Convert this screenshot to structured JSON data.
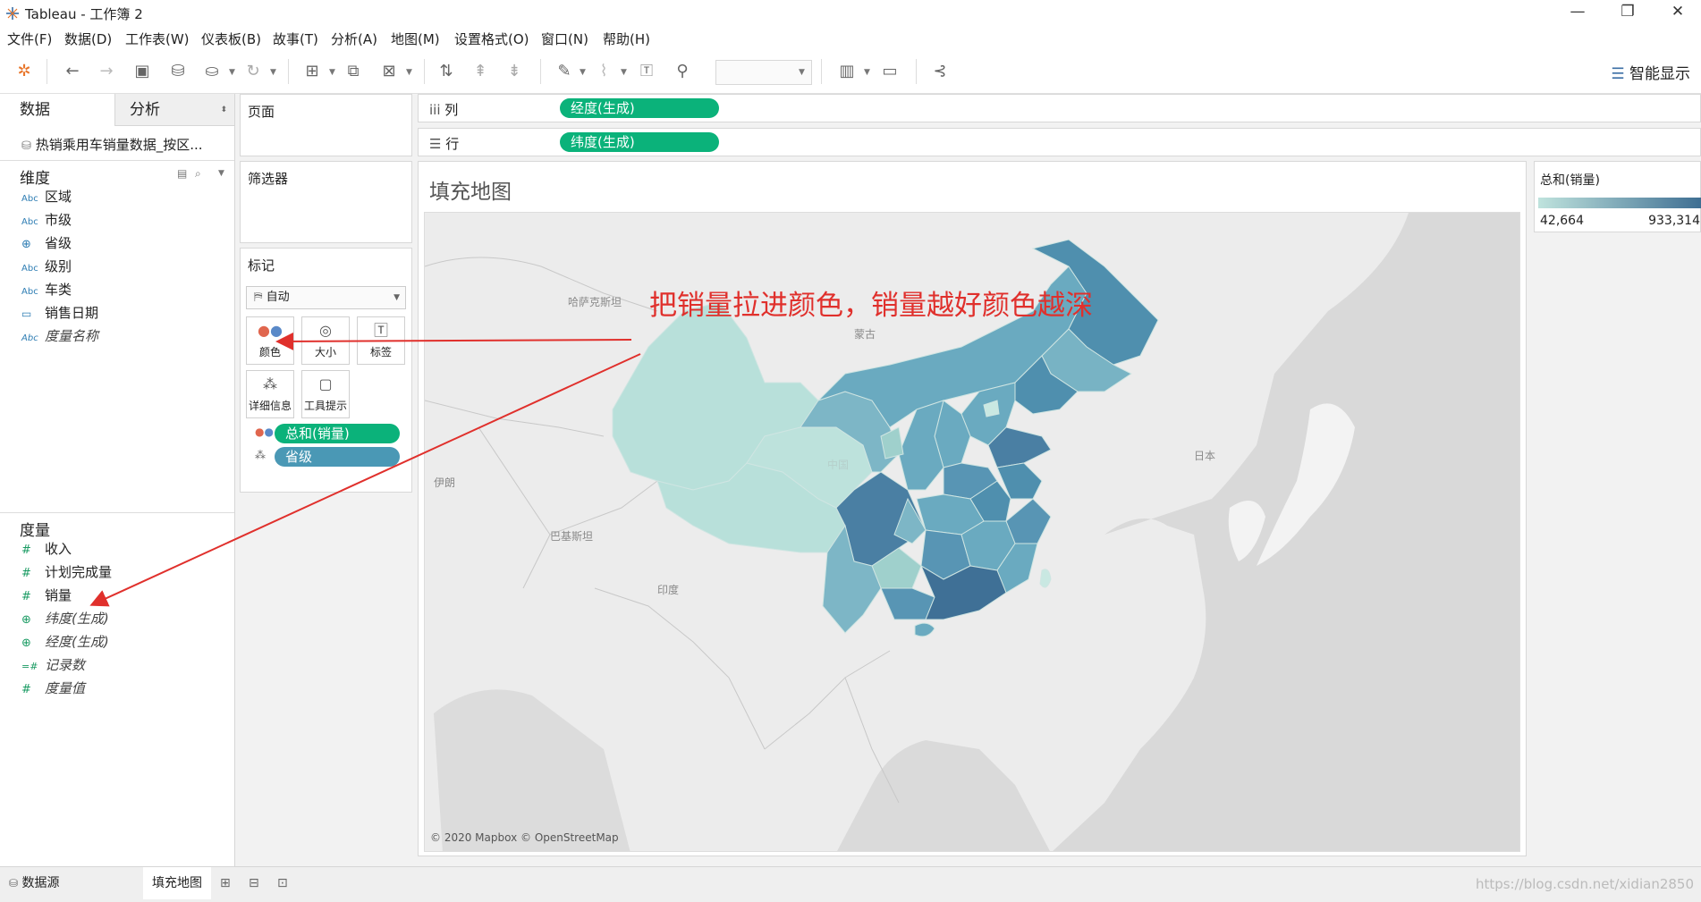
{
  "window": {
    "title": "Tableau - 工作簿 2",
    "minimize": "—",
    "restore": "❐",
    "close": "✕"
  },
  "menu": [
    "文件(F)",
    "数据(D)",
    "工作表(W)",
    "仪表板(B)",
    "故事(T)",
    "分析(A)",
    "地图(M)",
    "设置格式(O)",
    "窗口(N)",
    "帮助(H)"
  ],
  "toolbar": {
    "smart_show": "智能显示"
  },
  "leftpane": {
    "tab_data": "数据",
    "tab_analysis": "分析",
    "datasource": "热销乘用车销量数据_按区...",
    "dimensions_title": "维度",
    "dimensions": [
      {
        "type": "Abc",
        "name": "区域",
        "italic": false
      },
      {
        "type": "Abc",
        "name": "市级",
        "italic": false
      },
      {
        "type": "geo",
        "name": "省级",
        "italic": false
      },
      {
        "type": "Abc",
        "name": "级别",
        "italic": false
      },
      {
        "type": "Abc",
        "name": "车类",
        "italic": false
      },
      {
        "type": "date",
        "name": "销售日期",
        "italic": false
      },
      {
        "type": "Abc",
        "name": "度量名称",
        "italic": true
      }
    ],
    "measures_title": "度量",
    "measures": [
      {
        "type": "#",
        "name": "收入",
        "italic": false
      },
      {
        "type": "#",
        "name": "计划完成量",
        "italic": false
      },
      {
        "type": "#",
        "name": "销量",
        "italic": false
      },
      {
        "type": "geo",
        "name": "纬度(生成)",
        "italic": true
      },
      {
        "type": "geo",
        "name": "经度(生成)",
        "italic": true
      },
      {
        "type": "=#",
        "name": "记录数",
        "italic": true
      },
      {
        "type": "#",
        "name": "度量值",
        "italic": true
      }
    ]
  },
  "pages": {
    "title": "页面"
  },
  "filters": {
    "title": "筛选器"
  },
  "marks": {
    "title": "标记",
    "type_value": "自动",
    "buttons": [
      "颜色",
      "大小",
      "标签",
      "详细信息",
      "工具提示"
    ],
    "pills": [
      "总和(销量)",
      "省级"
    ]
  },
  "columns": {
    "label": "列",
    "pill": "经度(生成)"
  },
  "rows": {
    "label": "行",
    "pill": "纬度(生成)"
  },
  "view": {
    "title": "填充地图",
    "copyright": "© 2020 Mapbox © OpenStreetMap",
    "map_labels": {
      "kazakhstan": "哈萨克斯坦",
      "mongolia": "蒙古",
      "japan": "日本",
      "iran": "伊朗",
      "pakistan": "巴基斯坦",
      "india": "印度",
      "faint_china": "中国"
    }
  },
  "annotation": "把销量拉进颜色，销量越好颜色越深",
  "legend": {
    "title": "总和(销量)",
    "min": "42,664",
    "max": "933,314",
    "color_low": "#bfe3dd",
    "color_high": "#3e6e92"
  },
  "bottom": {
    "datasource_tab": "数据源",
    "sheet_tab": "填充地图"
  },
  "watermark": "https://blog.csdn.net/xidian2850"
}
